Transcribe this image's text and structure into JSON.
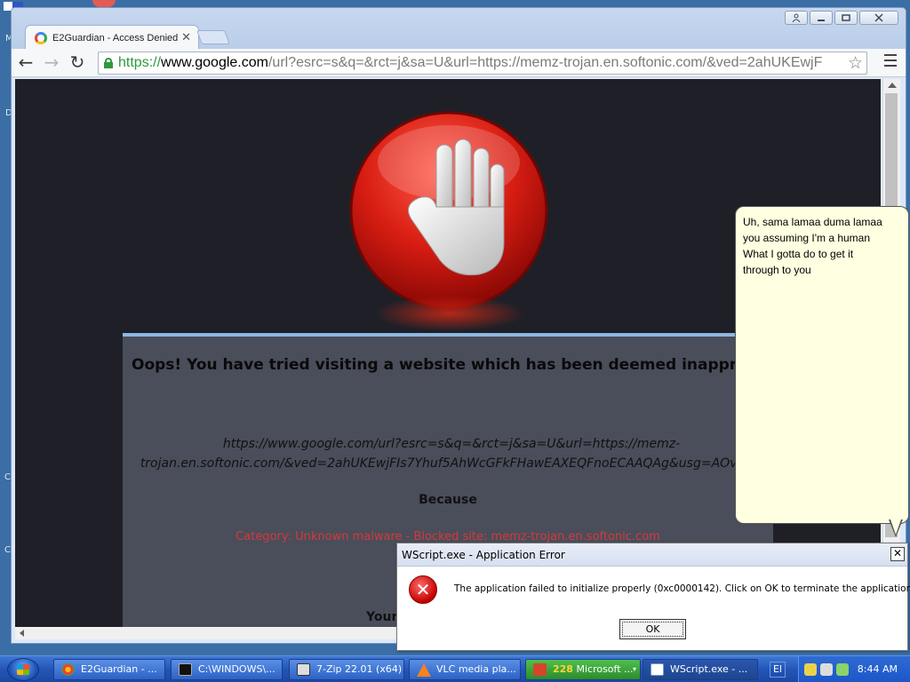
{
  "desktop": {
    "fragments": [
      "M",
      "D",
      "C",
      "C"
    ]
  },
  "browser": {
    "tab_title": "E2Guardian - Access Denied",
    "tab_close": "✕",
    "url_scheme": "https://",
    "url_host": "www.google.com",
    "url_path": "/url?esrc=s&q=&rct=j&sa=U&url=https://memz-trojan.en.softonic.com/&ved=2ahUKEwjF",
    "back": "←",
    "forward": "→",
    "reload": "↻",
    "star": "☆"
  },
  "page": {
    "heading": "Oops! You have tried visiting a website which has been deemed inappropriate",
    "blocked_url_line1": "https://www.google.com/url?esrc=s&q=&rct=j&sa=U&url=https://memz-",
    "blocked_url_line2": "trojan.en.softonic.com/&ved=2ahUKEwjFIs7Yhuf5AhWcGFkFHawEAXEQFnoECAAQAg&usg=AOvVaw",
    "because": "Because",
    "category": "Category: Unknown malware  -  Blocked site: memz-trojan.en.softonic.com",
    "your": "Your"
  },
  "balloon": {
    "line1": "Uh, sama lamaa duma lamaa",
    "line2": "you assuming I'm a human",
    "line3": "What I gotta do to get it",
    "line4": "through to you"
  },
  "dialog": {
    "title": "WScript.exe - Application Error",
    "message": "The application failed to initialize properly (0xc0000142). Click on OK to terminate the application.",
    "ok": "OK",
    "close": "✕"
  },
  "taskbar": {
    "items": [
      {
        "label": "E2Guardian - ...",
        "icon_color": "#ea4335"
      },
      {
        "label": "C:\\WINDOWS\\...",
        "icon_color": "#111111"
      },
      {
        "label": "7-Zip 22.01 (x64)",
        "icon_color": "#dddddd"
      },
      {
        "label": "VLC media pla...",
        "icon_color": "#f58220"
      },
      {
        "label_num": "228",
        "label": "Microsoft ...",
        "icon_color": "#d6442c"
      },
      {
        "label": "WScript.exe - ...",
        "icon_color": "#ffffff"
      }
    ],
    "lang": "El",
    "clock": "8:44 AM"
  },
  "colors": {
    "url_green": "#2e9a3a",
    "page_bg": "#1f2027",
    "card_bg": "#4a4d5a",
    "category_red": "#d43a3a",
    "balloon_bg": "#ffffe1",
    "taskbar_blue": "#2355b7"
  }
}
